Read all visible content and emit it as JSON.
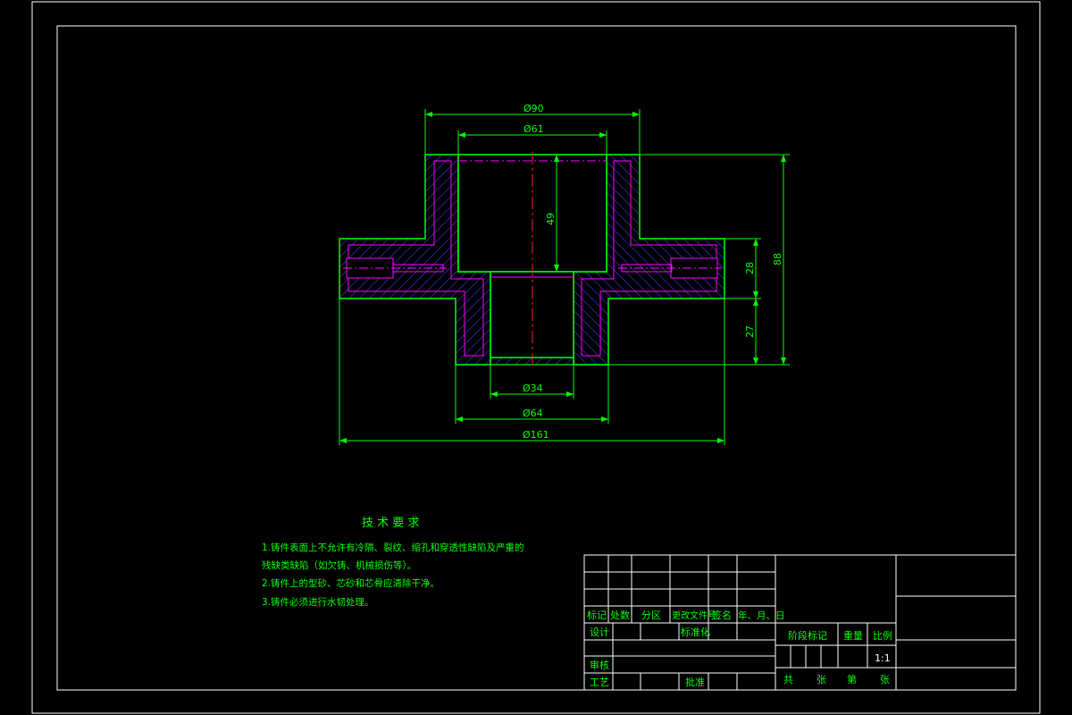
{
  "dimensions": {
    "d90": "Ø90",
    "d61": "Ø61",
    "d34": "Ø34",
    "d64": "Ø64",
    "d161": "Ø161",
    "h49": "49",
    "h28": "28",
    "h88": "88",
    "h27": "27"
  },
  "notes": {
    "title": "技 术 要 求",
    "line1": "1.铸件表面上不允许有冷隔、裂纹、缩孔和穿透性缺陷及严重的",
    "line2": "残缺类缺陷（如欠铸、机械损伤等）。",
    "line3": "2.铸件上的型砂、芯砂和芯骨应清除干净。",
    "line4": "3.铸件必须进行水韧处理。"
  },
  "title_block": {
    "col_biaoji": "标记",
    "col_chushu": "处数",
    "col_fenqu": "分区",
    "col_gengai": "更改文件号",
    "col_qianming": "签名",
    "col_date": "年、月、日",
    "sheji": "设计",
    "biaozhunhua": "标准化",
    "shenhe": "审核",
    "gongyi": "工艺",
    "pizhun": "批准",
    "jieduan": "阶段标记",
    "zhongliang": "重量",
    "bili": "比例",
    "scale": "1:1",
    "gong": "共",
    "zhang1": "张",
    "di": "第",
    "zhang2": "张"
  },
  "colors": {
    "outline": "#00ff00",
    "dimension": "#00ff00",
    "hatch": "#3a3aff",
    "center": "#ff00ff",
    "frame": "#ffffff",
    "text": "#00ff00"
  }
}
